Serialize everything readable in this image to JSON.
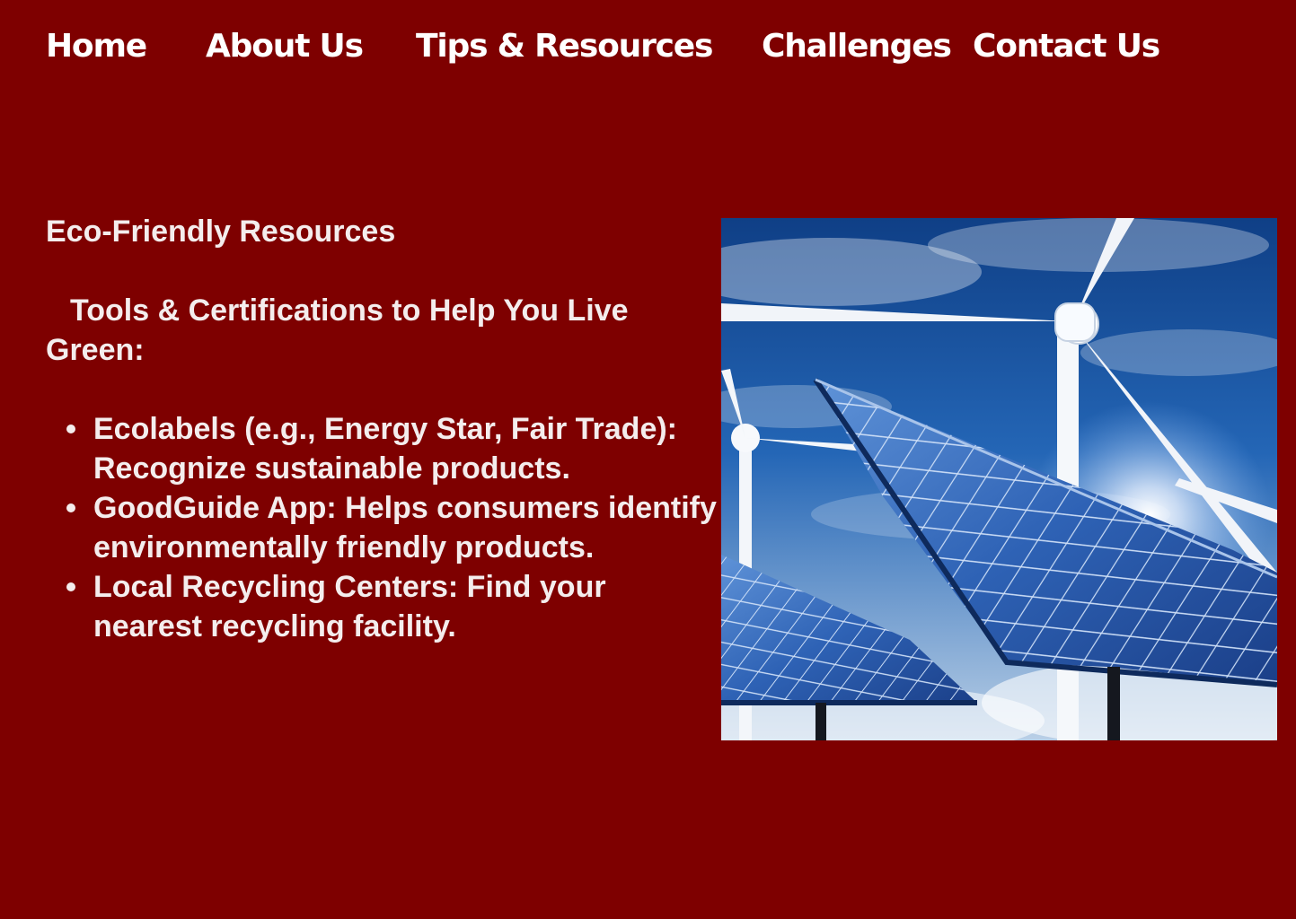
{
  "nav": {
    "items": [
      {
        "label": "Home"
      },
      {
        "label": "About Us"
      },
      {
        "label": "Tips & Resources"
      },
      {
        "label": "Challenges"
      },
      {
        "label": "Contact Us"
      }
    ]
  },
  "main": {
    "title": "Eco-Friendly Resources",
    "subtitle": "Tools & Certifications to Help You Live Green:",
    "resources": [
      {
        "text": "Ecolabels (e.g., Energy Star, Fair Trade): Recognize sustainable products."
      },
      {
        "text": "GoodGuide App: Helps consumers identify environmentally friendly products."
      },
      {
        "text": "Local Recycling Centers: Find your nearest recycling facility."
      }
    ]
  },
  "image": {
    "icon": "solar-panels-wind-turbines-photo"
  },
  "colors": {
    "background": "#7e0000",
    "text": "#ffffff",
    "sky": "#1d5aa8",
    "panel": "#2f6fc6"
  }
}
